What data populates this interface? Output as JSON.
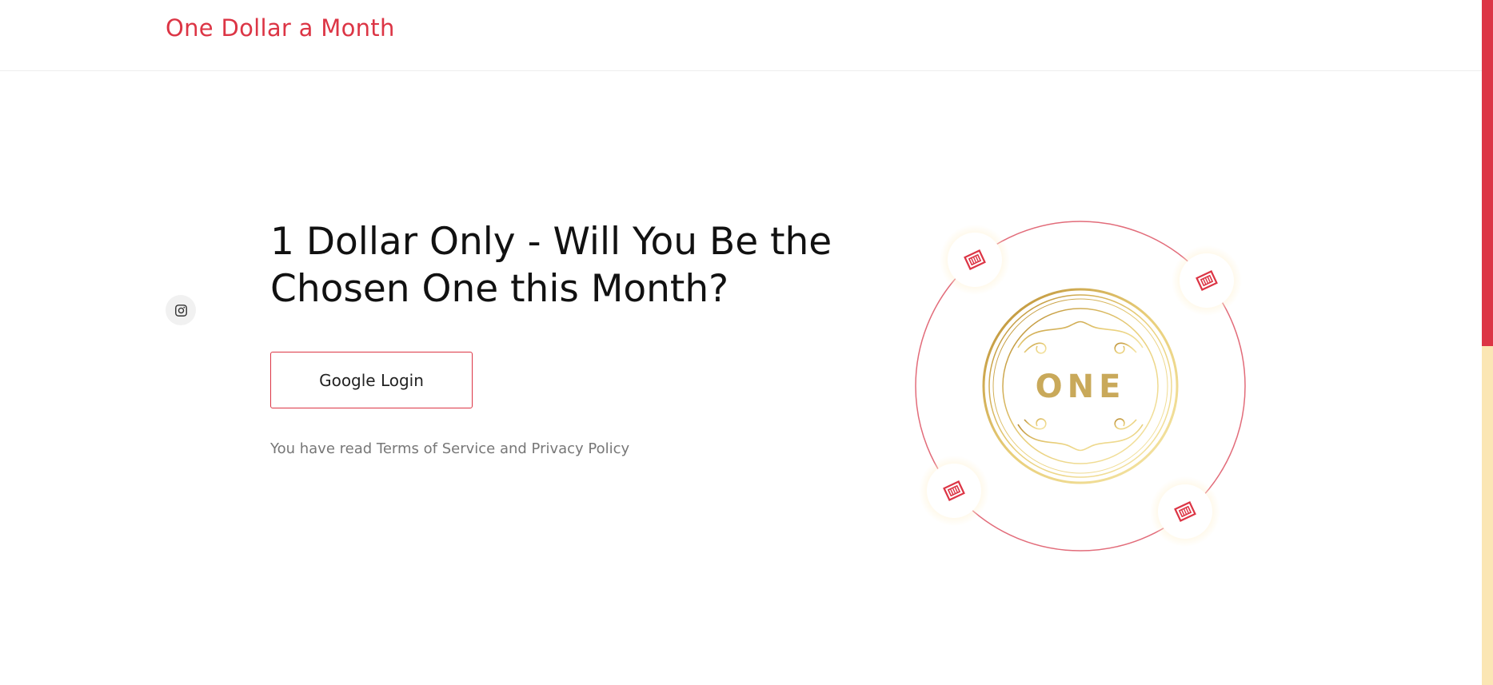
{
  "header": {
    "brand": "One Dollar a Month"
  },
  "social": {
    "instagram_icon": "instagram-icon"
  },
  "hero": {
    "headline": "1 Dollar Only - Will You Be the Chosen One this Month?",
    "login_button": "Google Login",
    "terms_prefix": "You have read ",
    "terms_link": "Terms of Service",
    "terms_and": " and ",
    "privacy_link": "Privacy Policy"
  },
  "coin": {
    "text": "ONE",
    "orbit_icon": "dollar-bill-icon"
  },
  "colors": {
    "accent": "#dc3545",
    "gold": "#c9a95a",
    "scroll_track": "#fbe6b4"
  }
}
